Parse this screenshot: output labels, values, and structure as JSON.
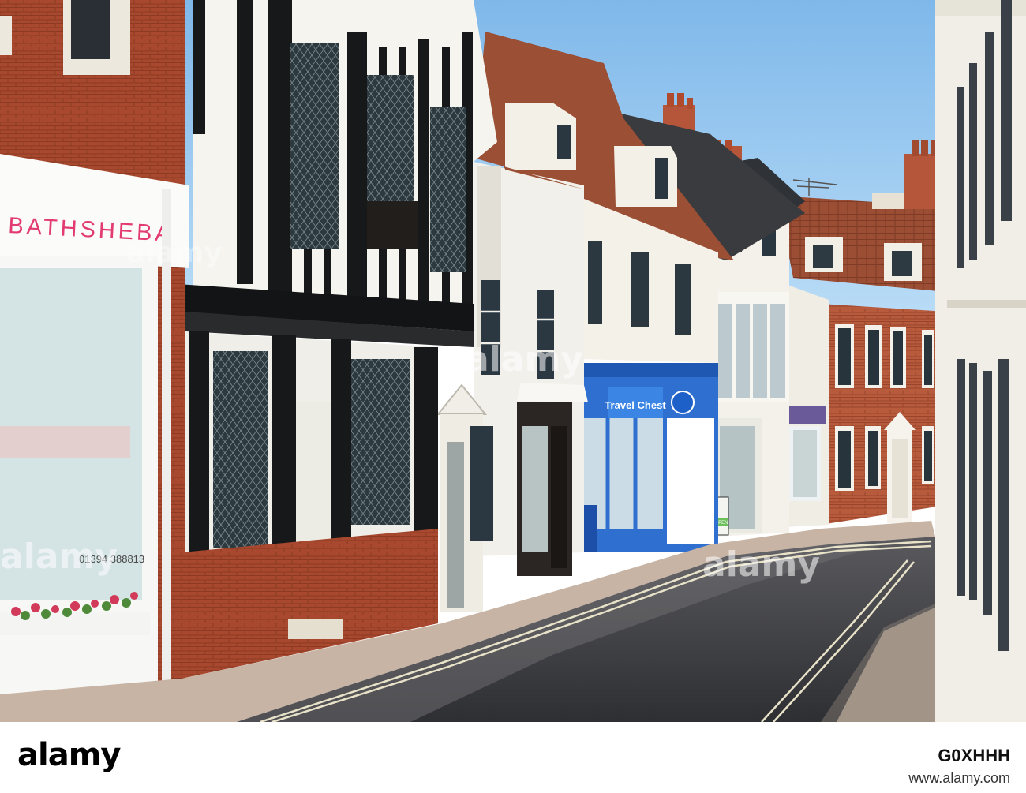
{
  "signs": {
    "bathsheba": "BATHSHEBA",
    "phone": "01394 388813",
    "travel": "Travel Chest",
    "open": "OPEN"
  },
  "watermark": {
    "logo": "alamy",
    "left": "alamy",
    "center": "alamy",
    "right": "alamy"
  },
  "footer": {
    "logo": "alamy",
    "image_id": "G0XHHH",
    "site": "www.alamy.com"
  },
  "colors": {
    "sky": "#8ec3ee",
    "brick": "#a5472d",
    "travel_blue": "#2f6fd0"
  }
}
